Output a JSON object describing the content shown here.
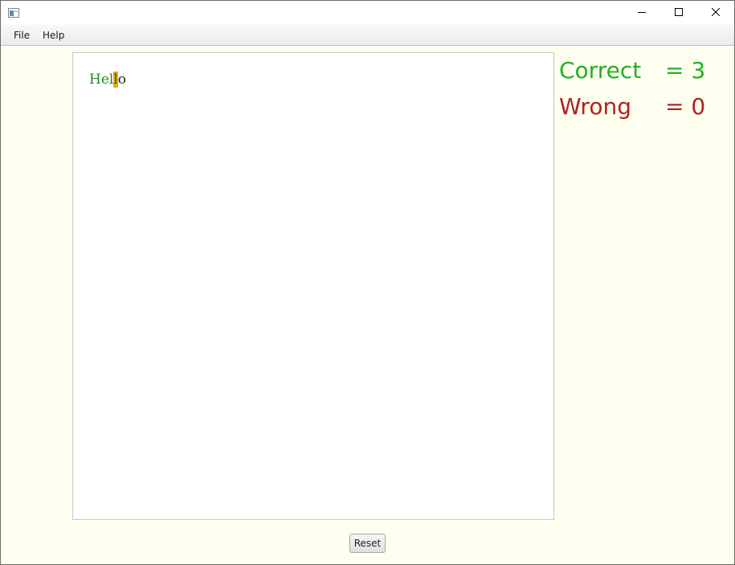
{
  "menubar": {
    "file_label": "File",
    "help_label": "Help"
  },
  "editor": {
    "typed_text": "Hel",
    "current_char": "l",
    "remaining_text": "o"
  },
  "score": {
    "correct_label": "Correct",
    "correct_value": "= 3",
    "wrong_label": "Wrong",
    "wrong_value": "= 0"
  },
  "reset_label": "Reset",
  "colors": {
    "background": "#fffff0",
    "correct": "#22b022",
    "wrong": "#b02222",
    "cursor_highlight": "#f5a800"
  },
  "icons": {
    "app": "app-window-icon",
    "minimize": "minimize-icon",
    "maximize": "maximize-icon",
    "close": "close-icon"
  }
}
